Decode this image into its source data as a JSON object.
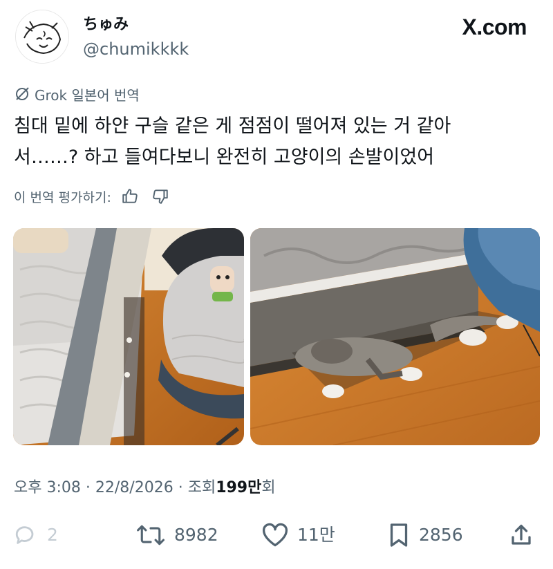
{
  "author": {
    "display_name": "ちゅみ",
    "handle": "@chumikkkk"
  },
  "brand": "X.com",
  "translation": {
    "label": "Grok 일본어 번역",
    "text_lines": [
      "침대 밑에 하얀 구슬 같은 게 점점이 떨어져 있는 거 같아",
      "서……? 하고 들여다보니 완전히 고양이의 손발이었어"
    ],
    "rate_label": "이 번역 평가하기:"
  },
  "media": {
    "left_alt": "",
    "right_alt": ""
  },
  "meta": {
    "time": "오후 3:08",
    "date": "22/8/2026",
    "views_prefix": "조회",
    "views_number": "199만",
    "views_suffix": "회",
    "separator": "·"
  },
  "actions": {
    "reply_count": "2",
    "retweet_count": "8982",
    "like_count": "11만",
    "bookmark_count": "2856"
  },
  "icons": {
    "grok": "grok-icon",
    "thumbs_up": "thumbs-up-icon",
    "thumbs_down": "thumbs-down-icon",
    "reply": "reply-icon",
    "retweet": "retweet-icon",
    "like": "heart-icon",
    "bookmark": "bookmark-icon",
    "share": "share-icon"
  },
  "colors": {
    "text_primary": "#0f1419",
    "text_secondary": "#536471",
    "reply_faded": "#c4ccd3",
    "floor": "#c8731f"
  }
}
